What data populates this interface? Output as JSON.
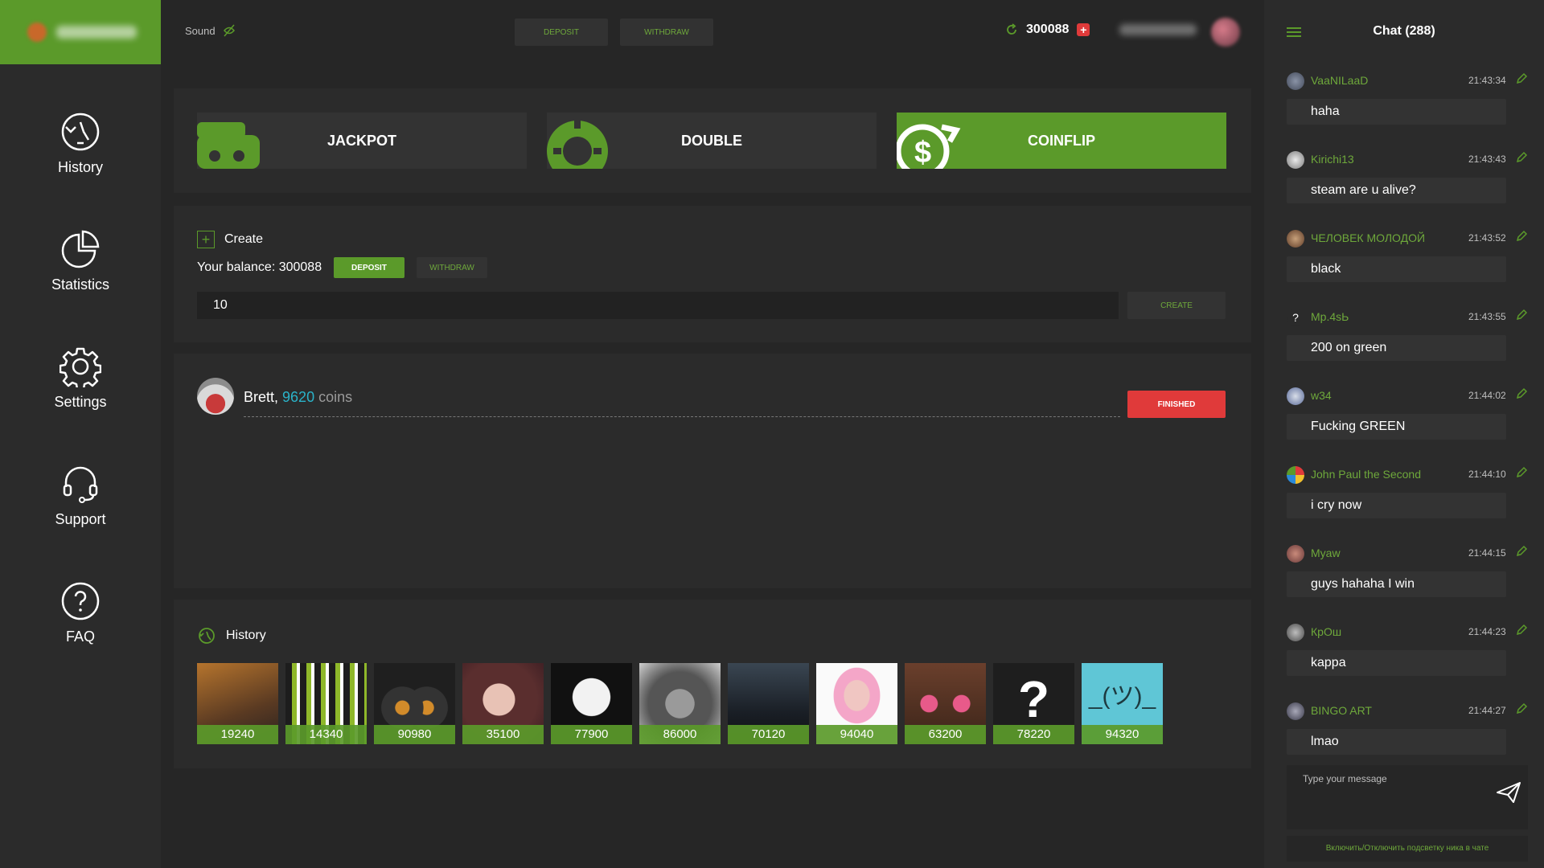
{
  "sidebar": {
    "items": [
      {
        "label": "History",
        "icon": "history-icon"
      },
      {
        "label": "Statistics",
        "icon": "pie-chart-icon"
      },
      {
        "label": "Settings",
        "icon": "gear-icon"
      },
      {
        "label": "Support",
        "icon": "headset-icon"
      },
      {
        "label": "FAQ",
        "icon": "question-circle-icon"
      }
    ]
  },
  "topbar": {
    "sound_label": "Sound",
    "deposit_label": "DEPOSIT",
    "withdraw_label": "WITHDRAW",
    "balance": "300088"
  },
  "games": {
    "tabs": [
      {
        "label": "JACKPOT",
        "active": false
      },
      {
        "label": "DOUBLE",
        "active": false
      },
      {
        "label": "COINFLIP",
        "active": true
      }
    ]
  },
  "create": {
    "title": "Create",
    "balance_text": "Your balance: 300088",
    "deposit_label": "DEPOSIT",
    "withdraw_label": "WITHDRAW",
    "amount_value": "10",
    "create_label": "CREATE"
  },
  "game_row": {
    "name": "Brett,",
    "coins": "9620",
    "unit": "coins",
    "status": "FINISHED"
  },
  "history": {
    "title": "History",
    "items": [
      "19240",
      "14340",
      "90980",
      "35100",
      "77900",
      "86000",
      "70120",
      "94040",
      "63200",
      "78220",
      "94320"
    ]
  },
  "chat": {
    "title": "Chat (288)",
    "messages": [
      {
        "name": "VaaNILaaD",
        "time": "21:43:34",
        "text": "haha"
      },
      {
        "name": "Kirichi13",
        "time": "21:43:43",
        "text": "steam are u alive?"
      },
      {
        "name": "ЧЕЛОВЕК МОЛОДОЙ",
        "time": "21:43:52",
        "text": "black"
      },
      {
        "name": "Mp.4sЬ",
        "time": "21:43:55",
        "text": "200 on green"
      },
      {
        "name": "w34",
        "time": "21:44:02",
        "text": "Fucking GREEN"
      },
      {
        "name": "John Paul the Second",
        "time": "21:44:10",
        "text": "i cry now"
      },
      {
        "name": "Myaw",
        "time": "21:44:15",
        "text": "guys hahaha I win"
      },
      {
        "name": "КрОш",
        "time": "21:44:23",
        "text": "kappa"
      },
      {
        "name": "BINGO ART",
        "time": "21:44:27",
        "text": "lmao"
      }
    ],
    "input_placeholder": "Type your message",
    "toggle_label": "Включить/Отключить подсветку ника в чате"
  },
  "colors": {
    "accent": "#5b9a2a",
    "danger": "#e03a3a",
    "coins": "#2ab3c9"
  }
}
